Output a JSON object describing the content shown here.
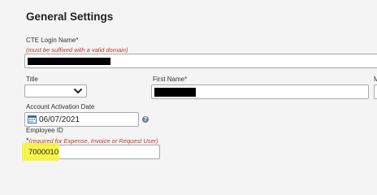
{
  "section_title": "General Settings",
  "login": {
    "label": "CTE Login Name*",
    "note": "(must be suffixed with a valid domain)"
  },
  "title_field": {
    "label": "Title",
    "selected": ""
  },
  "first_name": {
    "label": "First Name*"
  },
  "middle_name": {
    "label": "M"
  },
  "activation": {
    "label": "Account Activation Date",
    "value": "06/07/2021"
  },
  "employee": {
    "label": "Employee ID",
    "asterisk": "*",
    "note": "(required for Expense, Invoice or Request User)",
    "value": "7000010"
  },
  "colors": {
    "background": "#f4f4f4",
    "required_note": "#c0392b",
    "highlight": "#f7f43a",
    "help_icon": "#6a7f99"
  },
  "icons": [
    "chevron-down-icon",
    "calendar-icon",
    "help-icon"
  ]
}
